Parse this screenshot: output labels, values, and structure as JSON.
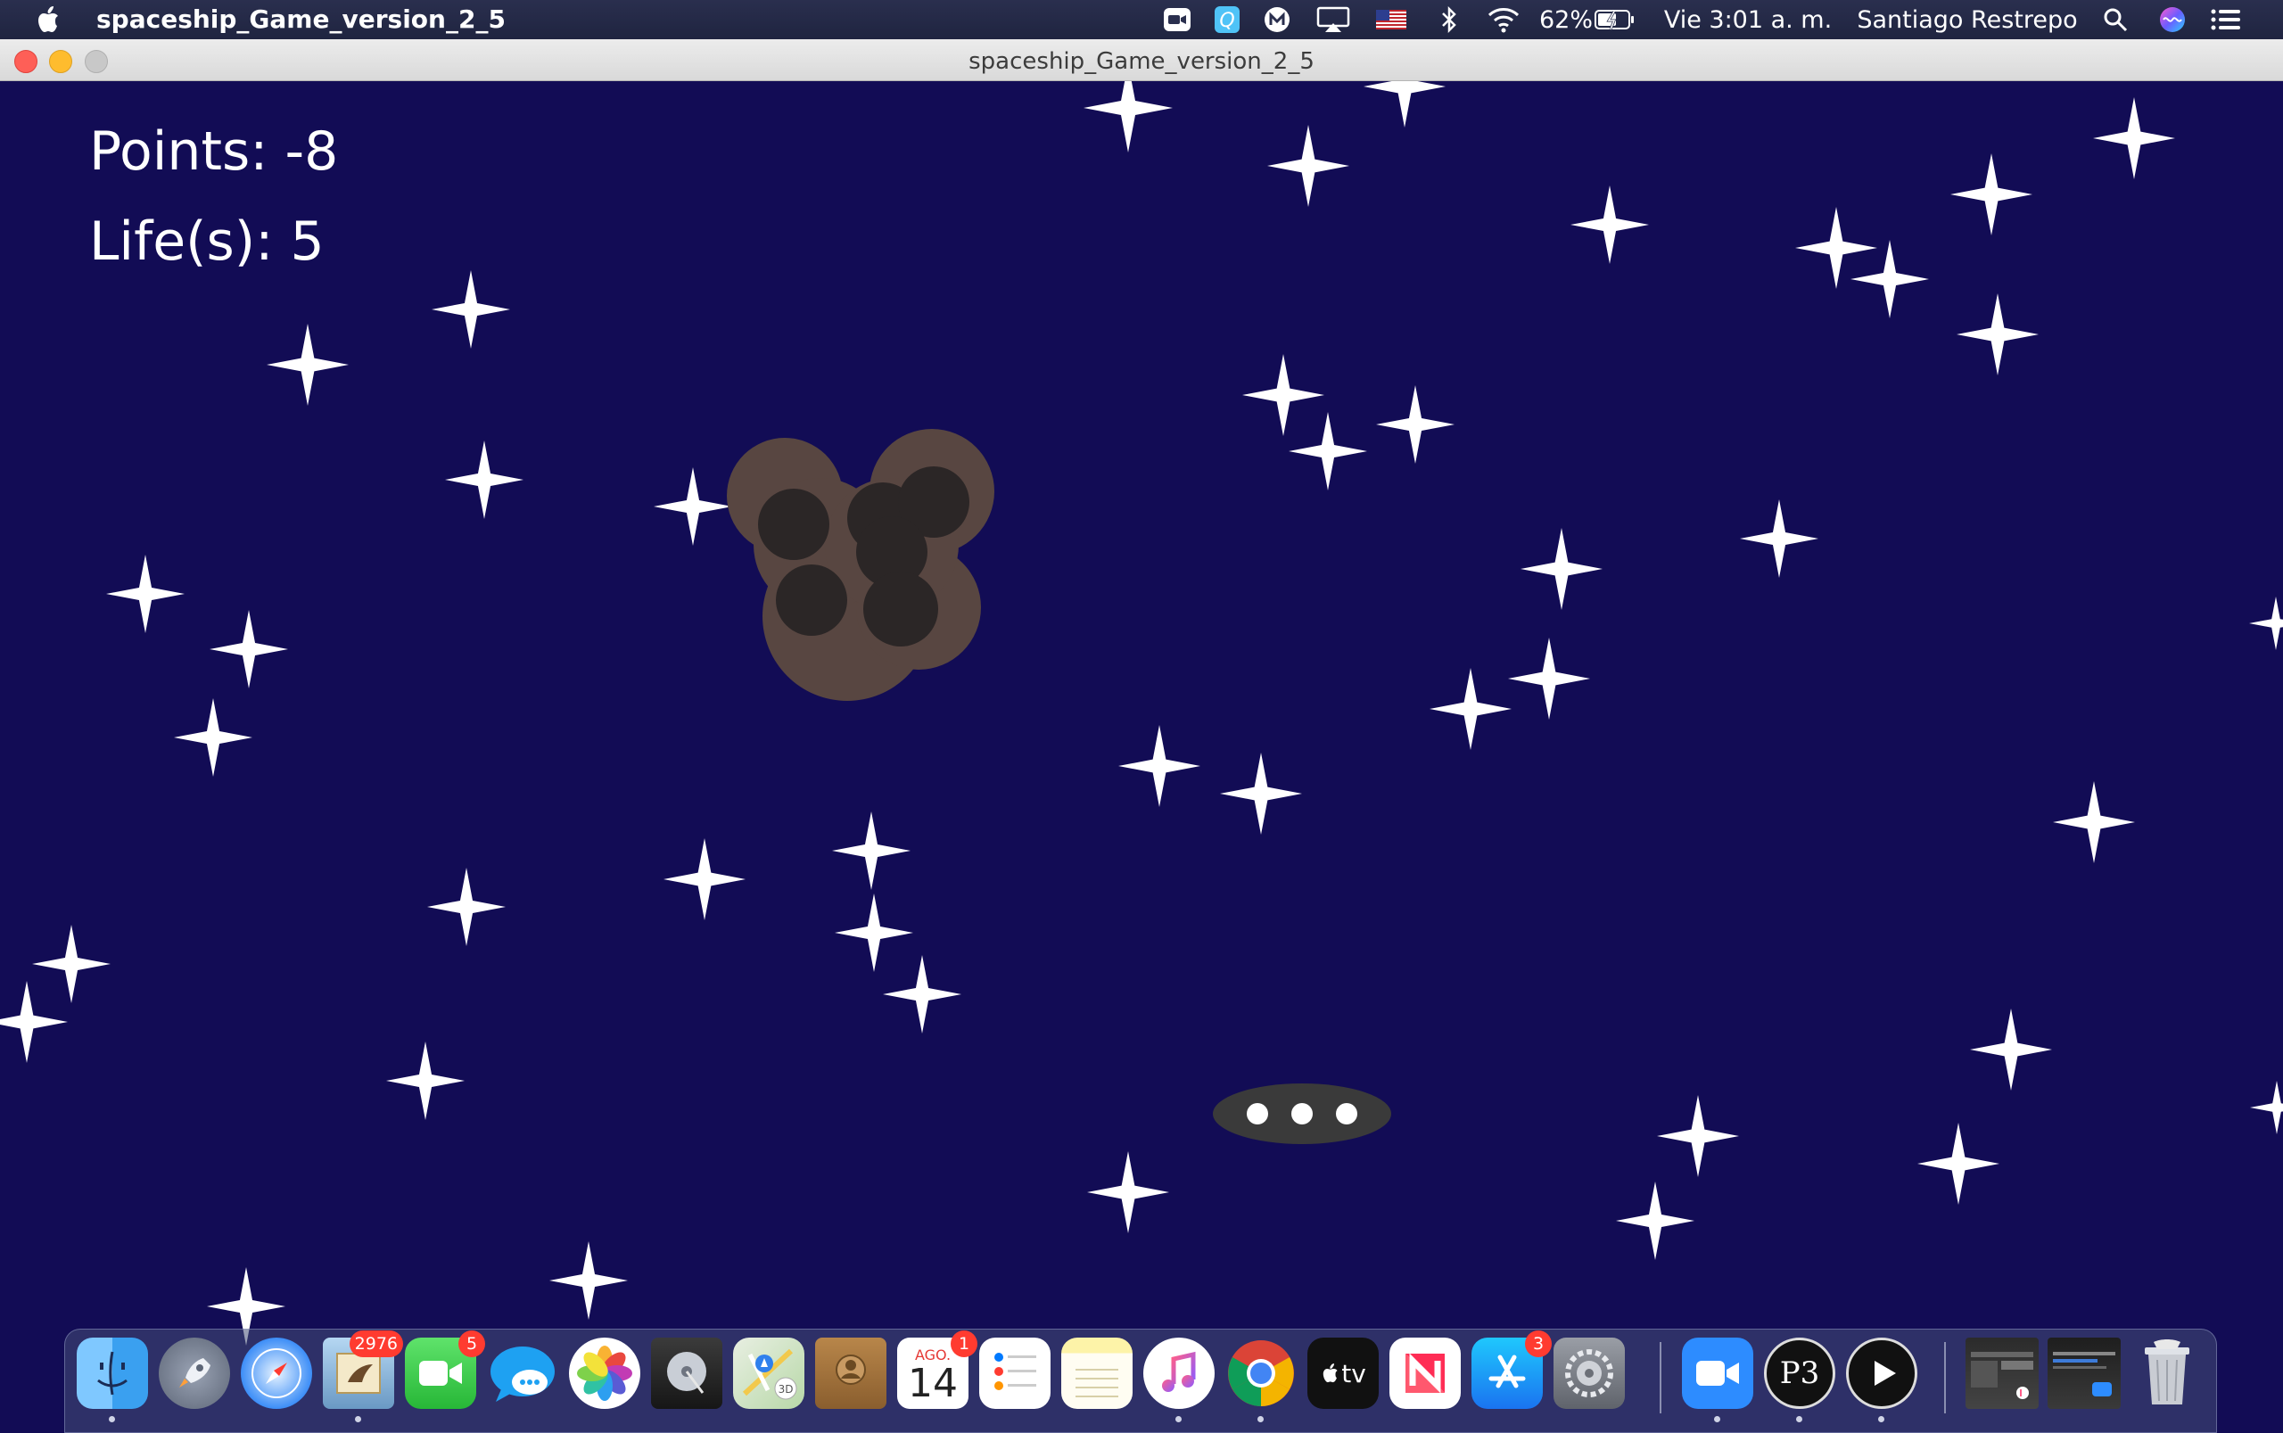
{
  "menubar": {
    "app_name": "spaceship_Game_version_2_5",
    "battery": "62%",
    "clock": "Vie 3:01 a. m.",
    "user": "Santiago Restrepo",
    "status_icons": [
      "zoom-icon",
      "quicktime-icon",
      "malwarebytes-icon",
      "airplay-icon",
      "us-flag-icon",
      "bluetooth-icon",
      "wifi-icon",
      "battery-icon",
      "search-icon",
      "siri-icon",
      "control-center-icon"
    ]
  },
  "window": {
    "title": "spaceship_Game_version_2_5"
  },
  "game": {
    "background_color": "#120c55",
    "points_label": "Points: -8",
    "lives_label": "Life(s): 5",
    "asteroid_color": "#584641",
    "ufo_color": "#3a3a3a"
  },
  "dock": {
    "apps": [
      {
        "name": "finder",
        "running": true
      },
      {
        "name": "launchpad"
      },
      {
        "name": "safari"
      },
      {
        "name": "mail",
        "badge": "2976",
        "running": true
      },
      {
        "name": "facetime",
        "badge": "5"
      },
      {
        "name": "messages"
      },
      {
        "name": "photos"
      },
      {
        "name": "disk-utility"
      },
      {
        "name": "maps"
      },
      {
        "name": "contacts"
      },
      {
        "name": "calendar",
        "badge": "1",
        "month": "AGO.",
        "day": "14"
      },
      {
        "name": "reminders"
      },
      {
        "name": "notes"
      },
      {
        "name": "music",
        "running": true
      },
      {
        "name": "chrome",
        "running": true
      },
      {
        "name": "apple-tv",
        "label": "tv"
      },
      {
        "name": "news"
      },
      {
        "name": "app-store",
        "badge": "3"
      },
      {
        "name": "system-preferences"
      },
      {
        "name": "zoom",
        "running": true
      },
      {
        "name": "processing",
        "label": "P3",
        "running": true
      },
      {
        "name": "processing-player",
        "running": true
      },
      {
        "name": "recent-window-1"
      },
      {
        "name": "recent-window-2"
      },
      {
        "name": "trash"
      }
    ]
  }
}
